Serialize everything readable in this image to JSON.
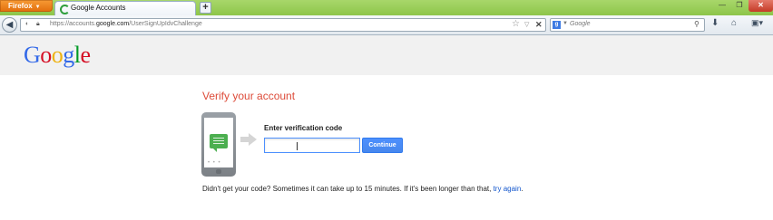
{
  "browser": {
    "menu_button": "Firefox",
    "tab_title": "Google Accounts",
    "new_tab_symbol": "+",
    "url_prefix": "https://accounts.",
    "url_domain": "google.com",
    "url_path": "/UserSignUpIdvChallenge",
    "search_placeholder": "Google",
    "icons": [
      "back-arrow-icon",
      "identity-icon",
      "lock-icon",
      "bookmark-star-icon",
      "dropdown-icon",
      "stop-icon",
      "google-search-engine-icon",
      "magnifier-icon",
      "download-icon",
      "home-icon",
      "more-icon",
      "minimize-icon",
      "maximize-icon",
      "close-icon"
    ]
  },
  "page": {
    "logo_letters": [
      {
        "char": "G",
        "color": "#3369e8"
      },
      {
        "char": "o",
        "color": "#d50f25"
      },
      {
        "char": "o",
        "color": "#eeb211"
      },
      {
        "char": "g",
        "color": "#3369e8"
      },
      {
        "char": "l",
        "color": "#009925"
      },
      {
        "char": "e",
        "color": "#d50f25"
      }
    ],
    "title": "Verify your account",
    "code_label": "Enter verification code",
    "code_value": "",
    "continue_label": "Continue",
    "help_text": "Didn't get your code? Sometimes it can take up to 15 minutes. If it's been longer than that, ",
    "help_link": "try again",
    "help_end": ".",
    "accent_color": "#dd4b39",
    "button_color": "#4d90fe"
  }
}
